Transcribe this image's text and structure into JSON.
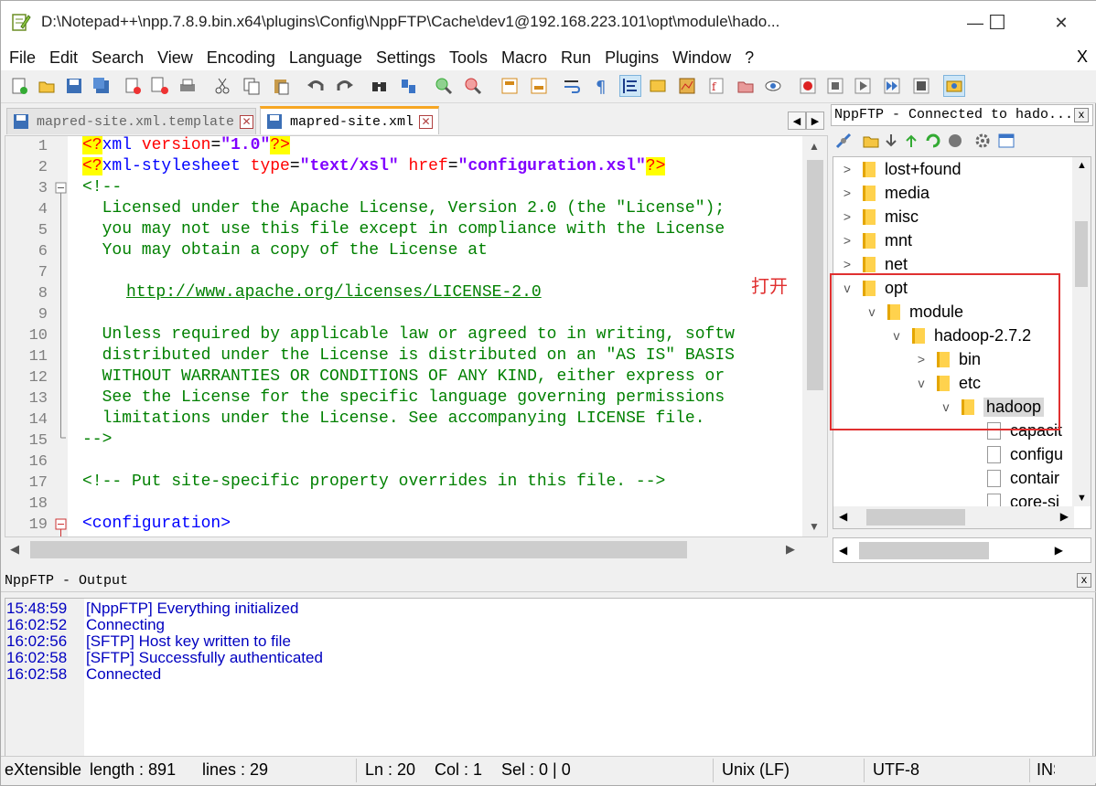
{
  "title": "D:\\Notepad++\\npp.7.8.9.bin.x64\\plugins\\Config\\NppFTP\\Cache\\dev1@192.168.223.101\\opt\\module\\hado...",
  "menu": [
    "File",
    "Edit",
    "Search",
    "View",
    "Encoding",
    "Language",
    "Settings",
    "Tools",
    "Macro",
    "Run",
    "Plugins",
    "Window",
    "?"
  ],
  "menu_close": "X",
  "window_buttons": {
    "minimize": "—",
    "maximize": "☐",
    "close": "✕"
  },
  "tabs": [
    {
      "label": "mapred-site.xml.template",
      "active": false
    },
    {
      "label": "mapred-site.xml",
      "active": true
    }
  ],
  "editor": {
    "line_numbers": [
      "1",
      "2",
      "3",
      "4",
      "5",
      "6",
      "7",
      "8",
      "9",
      "10",
      "11",
      "12",
      "13",
      "14",
      "15",
      "16",
      "17",
      "18",
      "19"
    ],
    "lines": [
      "<?xml version=\"1.0\"?>",
      "<?xml-stylesheet type=\"text/xsl\" href=\"configuration.xsl\"?>",
      "<!--",
      "  Licensed under the Apache License, Version 2.0 (the \"License\");",
      "  you may not use this file except in compliance with the License",
      "  You may obtain a copy of the License at",
      "",
      "    http://www.apache.org/licenses/LICENSE-2.0",
      "",
      "  Unless required by applicable law or agreed to in writing, softw",
      "  distributed under the License is distributed on an \"AS IS\" BASIS",
      "  WITHOUT WARRANTIES OR CONDITIONS OF ANY KIND, either express or",
      "  See the License for the specific language governing permissions",
      "  limitations under the License. See accompanying LICENSE file.",
      "-->",
      "",
      "<!-- Put site-specific property overrides in this file. -->",
      "",
      "<configuration>"
    ]
  },
  "annotation": "打开",
  "ftp": {
    "header": "NppFTP - Connected to hado...",
    "close": "x",
    "tree": [
      {
        "label": "lost+found",
        "kind": "folder",
        "state": "collapsed",
        "depth": 0
      },
      {
        "label": "media",
        "kind": "folder",
        "state": "collapsed",
        "depth": 0
      },
      {
        "label": "misc",
        "kind": "folder",
        "state": "collapsed",
        "depth": 0
      },
      {
        "label": "mnt",
        "kind": "folder",
        "state": "collapsed",
        "depth": 0
      },
      {
        "label": "net",
        "kind": "folder",
        "state": "collapsed",
        "depth": 0
      },
      {
        "label": "opt",
        "kind": "folder",
        "state": "expanded",
        "depth": 0
      },
      {
        "label": "module",
        "kind": "folder",
        "state": "expanded",
        "depth": 1
      },
      {
        "label": "hadoop-2.7.2",
        "kind": "folder",
        "state": "expanded",
        "depth": 2
      },
      {
        "label": "bin",
        "kind": "folder",
        "state": "collapsed",
        "depth": 3
      },
      {
        "label": "etc",
        "kind": "folder",
        "state": "expanded",
        "depth": 3
      },
      {
        "label": "hadoop",
        "kind": "folder",
        "state": "expanded",
        "depth": 4,
        "selected": true
      },
      {
        "label": "capacit",
        "kind": "file",
        "depth": 5
      },
      {
        "label": "configu",
        "kind": "file",
        "depth": 5
      },
      {
        "label": "contair",
        "kind": "file",
        "depth": 5
      },
      {
        "label": "core-si",
        "kind": "file",
        "depth": 5
      }
    ]
  },
  "output": {
    "header": "NppFTP - Output",
    "close": "x",
    "lines": [
      {
        "time": "15:48:59",
        "msg": "[NppFTP] Everything initialized"
      },
      {
        "time": "16:02:52",
        "msg": "Connecting"
      },
      {
        "time": "16:02:56",
        "msg": "[SFTP] Host key written to file"
      },
      {
        "time": "16:02:58",
        "msg": "[SFTP] Successfully authenticated"
      },
      {
        "time": "16:02:58",
        "msg": "Connected"
      }
    ]
  },
  "status": {
    "type": "eXtensible",
    "length": "length : 891",
    "lines": "lines : 29",
    "ln": "Ln : 20",
    "col": "Col : 1",
    "sel": "Sel : 0 | 0",
    "eol": "Unix (LF)",
    "enc": "UTF-8",
    "ins": "INS"
  },
  "colors": {
    "accent_tab": "#f6a623",
    "annotation": "#e03030",
    "output_text": "#0000c0"
  }
}
